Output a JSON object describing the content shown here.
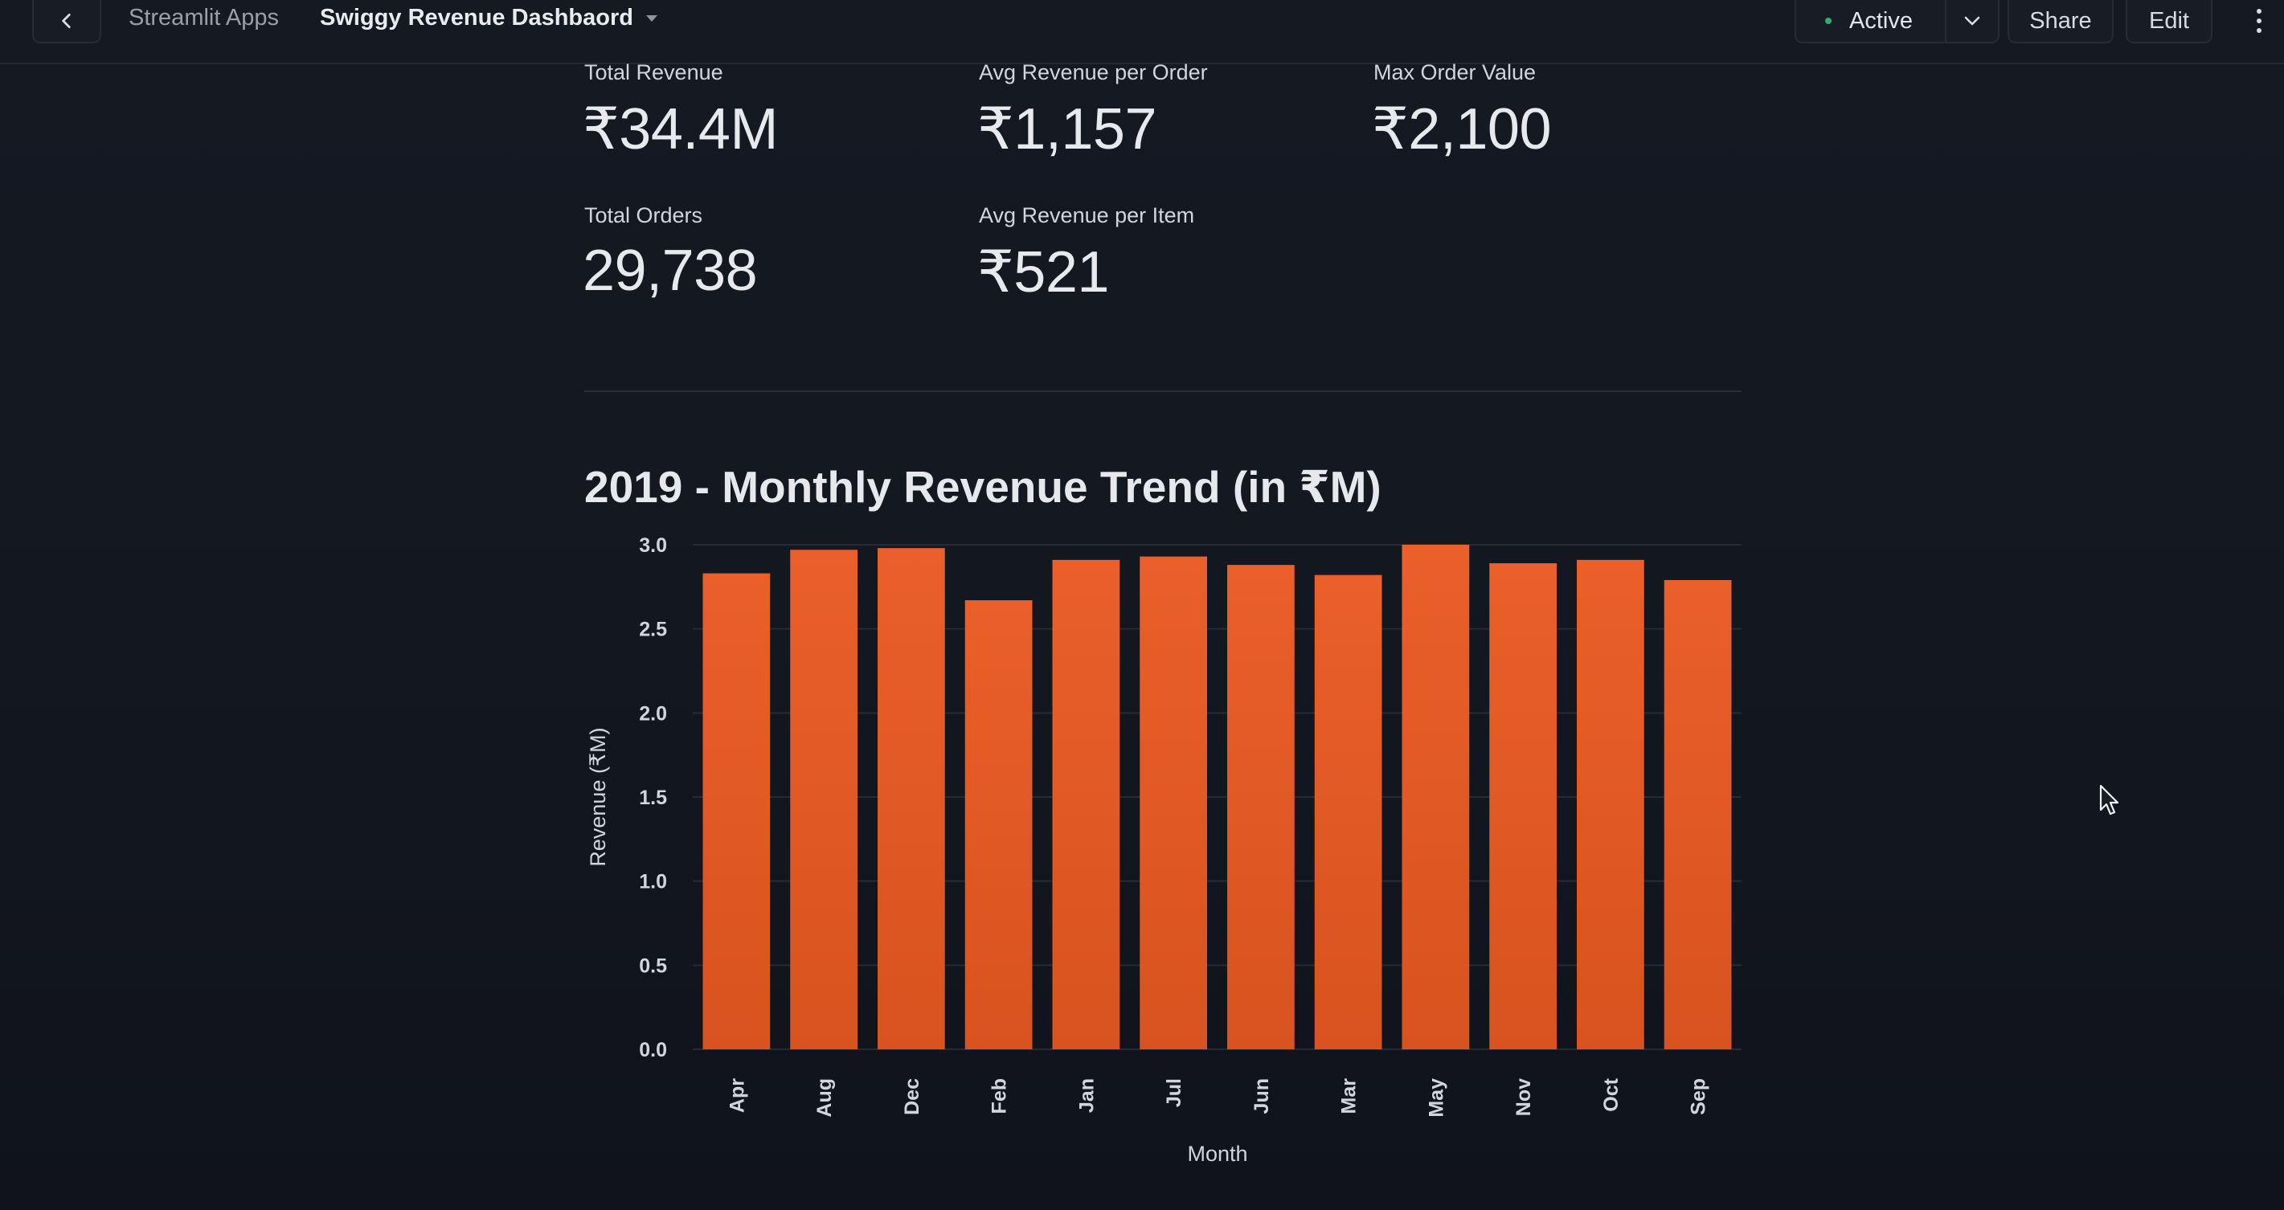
{
  "topbar": {
    "breadcrumb_root": "Streamlit Apps",
    "app_name": "Swiggy Revenue Dashbaord",
    "status": "Active",
    "share_label": "Share",
    "edit_label": "Edit"
  },
  "metrics": [
    {
      "label": "Total Revenue",
      "value": "₹34.4M"
    },
    {
      "label": "Avg Revenue per Order",
      "value": "₹1,157"
    },
    {
      "label": "Max Order Value",
      "value": "₹2,100"
    },
    {
      "label": "Total Orders",
      "value": "29,738"
    },
    {
      "label": "Avg Revenue per Item",
      "value": "₹521"
    }
  ],
  "colors": {
    "bar": "#ea5f2a",
    "bar_dark": "#d8531f",
    "grid": "#262b36",
    "accent_status": "#2fae72"
  },
  "chart_data": {
    "type": "bar",
    "title": "2019 - Monthly Revenue Trend (in ₹M)",
    "xlabel": "Month",
    "ylabel": "Revenue (₹M)",
    "categories": [
      "Apr",
      "Aug",
      "Dec",
      "Feb",
      "Jan",
      "Jul",
      "Jun",
      "Mar",
      "May",
      "Nov",
      "Oct",
      "Sep"
    ],
    "values": [
      2.83,
      2.97,
      2.98,
      2.67,
      2.91,
      2.93,
      2.88,
      2.82,
      3.0,
      2.89,
      2.91,
      2.79
    ],
    "ylim": [
      0,
      3.0
    ],
    "yticks": [
      "0.0",
      "0.5",
      "1.0",
      "1.5",
      "2.0",
      "2.5",
      "3.0"
    ],
    "grid": true
  }
}
